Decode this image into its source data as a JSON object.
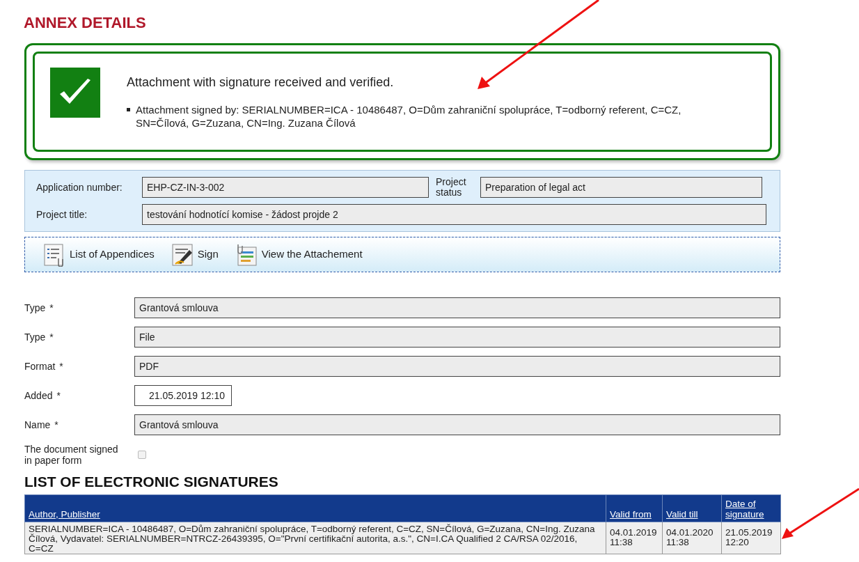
{
  "page_title": "ANNEX DETAILS",
  "notice": {
    "kind": "success",
    "message": "Attachment with signature received and verified.",
    "details": [
      "Attachment signed by: SERIALNUMBER=ICA - 10486487, O=Dům zahraniční spolupráce, T=odborný referent, C=CZ, SN=Čílová, G=Zuzana, CN=Ing. Zuzana Čílová"
    ]
  },
  "project": {
    "application_number": {
      "label": "Application number:",
      "value": "EHP-CZ-IN-3-002"
    },
    "project_status": {
      "label": "Project status",
      "value": "Preparation of legal act"
    },
    "project_title": {
      "label": "Project title:",
      "value": "testování hodnotící komise - žádost projde 2"
    }
  },
  "toolbar": [
    {
      "kind": "list",
      "label": "List of Appendices"
    },
    {
      "kind": "sign",
      "label": "Sign"
    },
    {
      "kind": "view",
      "label": "View the Attachement"
    }
  ],
  "form": [
    {
      "kind": "text",
      "label": "Type",
      "required_mark": "*",
      "value": "Grantová smlouva"
    },
    {
      "kind": "text",
      "label": "Type",
      "required_mark": "*",
      "value": "File"
    },
    {
      "kind": "text",
      "label": "Format",
      "required_mark": "*",
      "value": "PDF"
    },
    {
      "kind": "date",
      "label": "Added",
      "required_mark": "*",
      "value": "21.05.2019 12:10"
    },
    {
      "kind": "text",
      "label": "Name",
      "required_mark": "*",
      "value": "Grantová smlouva"
    },
    {
      "kind": "checkbox",
      "label": "The document signed in paper form",
      "checked": false
    }
  ],
  "signatures": {
    "title": "LIST OF ELECTRONIC SIGNATURES",
    "columns": [
      "Author, Publisher",
      "Valid from",
      "Valid till",
      "Date of signature"
    ],
    "rows": [
      [
        "SERIALNUMBER=ICA - 10486487, O=Dům zahraniční spolupráce, T=odborný referent, C=CZ, SN=Čílová, G=Zuzana, CN=Ing. Zuzana Čílová, Vydavatel: SERIALNUMBER=NTRCZ-26439395, O=\"První certifikační autorita, a.s.\", CN=I.CA Qualified 2 CA/RSA 02/2016, C=CZ",
        "04.01.2019 11:38",
        "04.01.2020 11:38",
        "21.05.2019 12:20"
      ]
    ]
  }
}
